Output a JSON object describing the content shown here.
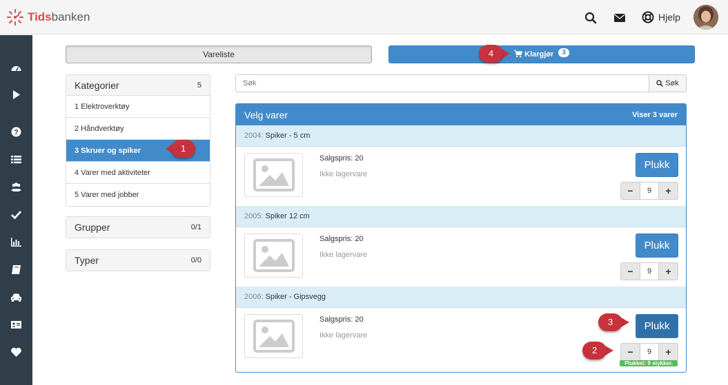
{
  "app": {
    "brand_bold": "Tids",
    "brand_regular": "banken",
    "help_label": "Hjelp"
  },
  "colors": {
    "primary": "#428bca",
    "sidebar": "#2f3e48",
    "brand_red": "#e04a4a",
    "callout": "#c8323c",
    "success": "#5cb85c"
  },
  "topnav": {
    "icons": [
      "search-icon",
      "envelope-icon",
      "lifebuoy-icon"
    ]
  },
  "sidebar": {
    "icons": [
      "dashboard-icon",
      "play-icon",
      "question-icon",
      "list-icon",
      "users-icon",
      "check-icon",
      "bar-chart-icon",
      "book-icon",
      "car-icon",
      "id-card-icon",
      "heart-icon"
    ]
  },
  "tabs": {
    "vareliste": "Vareliste",
    "klargjor": "Klargjør",
    "klargjor_badge": "3"
  },
  "callouts": {
    "one": "1",
    "two": "2",
    "three": "3",
    "four": "4"
  },
  "categories": {
    "title": "Kategorier",
    "count": "5",
    "items": [
      {
        "label": "1 Elektroverktøy",
        "active": false
      },
      {
        "label": "2 Håndverktøy",
        "active": false
      },
      {
        "label": "3 Skruer og spiker",
        "active": true
      },
      {
        "label": "4 Varer med aktiviteter",
        "active": false
      },
      {
        "label": "5 Varer med jobber",
        "active": false
      }
    ]
  },
  "groups": {
    "title": "Grupper",
    "count": "0/1"
  },
  "types": {
    "title": "Typer",
    "count": "0/0"
  },
  "search": {
    "placeholder": "Søk",
    "button": "Søk"
  },
  "products": {
    "title": "Velg varer",
    "count_label": "Viser 3 varer",
    "items": [
      {
        "number": "2004:",
        "name": "Spiker - 5 cm",
        "price": "Salgspris: 20",
        "stock": "Ikke lagervare",
        "pick_label": "Plukk",
        "qty": "9",
        "picked": ""
      },
      {
        "number": "2005:",
        "name": "Spiker 12 cm",
        "price": "Salgspris: 20",
        "stock": "Ikke lagervare",
        "pick_label": "Plukk",
        "qty": "9",
        "picked": ""
      },
      {
        "number": "2006:",
        "name": "Spiker - Gipsvegg",
        "price": "Salgspris: 20",
        "stock": "Ikke lagervare",
        "pick_label": "Plukk",
        "qty": "9",
        "picked": "Plukket: 9 stykker."
      }
    ]
  }
}
